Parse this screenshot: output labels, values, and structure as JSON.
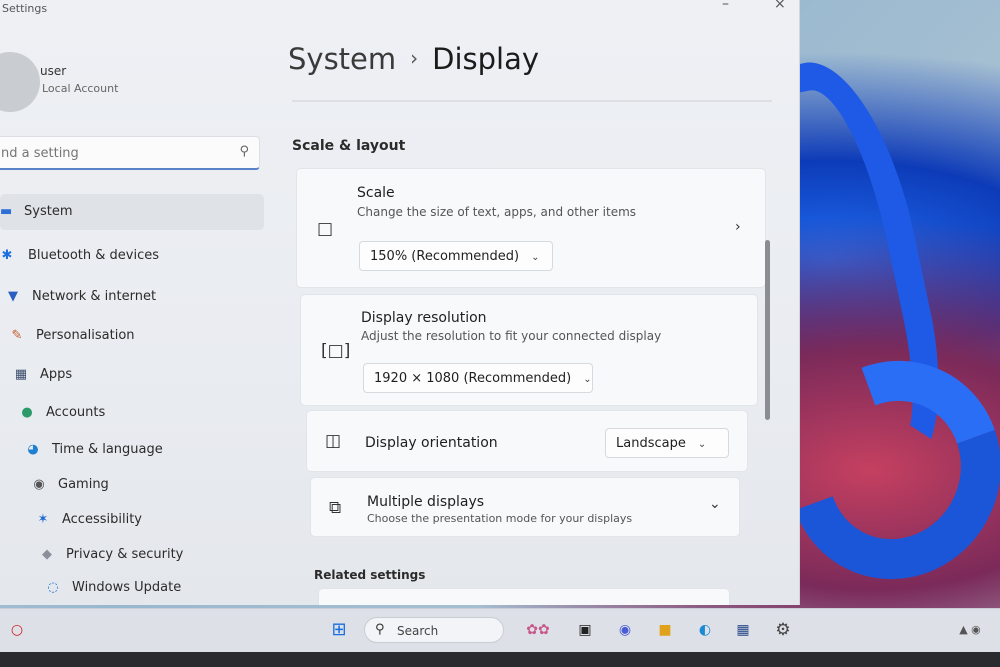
{
  "window": {
    "title": "Settings",
    "minimize": "–",
    "close": "×"
  },
  "profile": {
    "name": "user",
    "account_type": "Local Account"
  },
  "search": {
    "placeholder": "nd a setting",
    "icon": "search-icon"
  },
  "sidebar": {
    "items": [
      {
        "label": "System",
        "icon": "monitor-icon",
        "glyph": "▬",
        "color": "#2f6ed6",
        "active": true
      },
      {
        "label": "Bluetooth & devices",
        "icon": "bluetooth-icon",
        "glyph": "✱",
        "color": "#1d6fe0"
      },
      {
        "label": "Network & internet",
        "icon": "wifi-icon",
        "glyph": "▼",
        "color": "#2a5fc0"
      },
      {
        "label": "Personalisation",
        "icon": "brush-icon",
        "glyph": "✎",
        "color": "#c65a2a"
      },
      {
        "label": "Apps",
        "icon": "apps-icon",
        "glyph": "▦",
        "color": "#3a4a6a"
      },
      {
        "label": "Accounts",
        "icon": "person-icon",
        "glyph": "●",
        "color": "#2c9a6a"
      },
      {
        "label": "Time & language",
        "icon": "globe-icon",
        "glyph": "◕",
        "color": "#1f7fd1"
      },
      {
        "label": "Gaming",
        "icon": "gamepad-icon",
        "glyph": "◉",
        "color": "#555"
      },
      {
        "label": "Accessibility",
        "icon": "accessibility-icon",
        "glyph": "✶",
        "color": "#1c66d0"
      },
      {
        "label": "Privacy & security",
        "icon": "shield-icon",
        "glyph": "◆",
        "color": "#8a8f99"
      },
      {
        "label": "Windows Update",
        "icon": "update-icon",
        "glyph": "◌",
        "color": "#1e6fd8"
      }
    ]
  },
  "header": {
    "crumb_parent": "System",
    "separator": "›",
    "crumb_current": "Display"
  },
  "sections": {
    "scale_layout": "Scale & layout",
    "related": "Related settings"
  },
  "cards": {
    "scale": {
      "title": "Scale",
      "desc": "Change the size of text, apps, and other items",
      "value": "150% (Recommended)",
      "icon": "scale-icon",
      "chevron": "›"
    },
    "resolution": {
      "title": "Display resolution",
      "desc": "Adjust the resolution to fit your connected display",
      "value": "1920 × 1080 (Recommended)",
      "icon": "resolution-icon"
    },
    "orientation": {
      "title": "Display orientation",
      "value": "Landscape",
      "icon": "orientation-icon"
    },
    "multiple": {
      "title": "Multiple displays",
      "desc": "Choose the presentation mode for your displays",
      "icon": "multiple-displays-icon",
      "chevron": "⌄"
    }
  },
  "taskbar": {
    "search_label": "Search"
  }
}
